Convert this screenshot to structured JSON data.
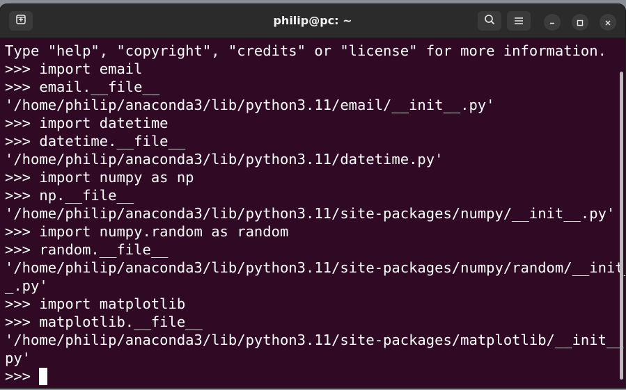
{
  "window": {
    "title": "philip@pc: ~",
    "background": "#300a24",
    "titlebar_color": "#2b2b2b"
  },
  "titlebar": {
    "new_tab_icon": "new-tab-icon",
    "search_icon": "search-icon",
    "menu_icon": "hamburger-menu-icon",
    "minimize_icon": "minimize-icon",
    "maximize_icon": "maximize-icon",
    "close_icon": "close-icon"
  },
  "terminal": {
    "lines": [
      "Type \"help\", \"copyright\", \"credits\" or \"license\" for more information.",
      ">>> import email",
      ">>> email.__file__",
      "'/home/philip/anaconda3/lib/python3.11/email/__init__.py'",
      ">>> import datetime",
      ">>> datetime.__file__",
      "'/home/philip/anaconda3/lib/python3.11/datetime.py'",
      ">>> import numpy as np",
      ">>> np.__file__",
      "'/home/philip/anaconda3/lib/python3.11/site-packages/numpy/__init__.py'",
      ">>> import numpy.random as random",
      ">>> random.__file__",
      "'/home/philip/anaconda3/lib/python3.11/site-packages/numpy/random/__init_",
      "_.py'",
      ">>> import matplotlib",
      ">>> matplotlib.__file__",
      "'/home/philip/anaconda3/lib/python3.11/site-packages/matplotlib/__init__.",
      "py'"
    ],
    "prompt": ">>> "
  }
}
